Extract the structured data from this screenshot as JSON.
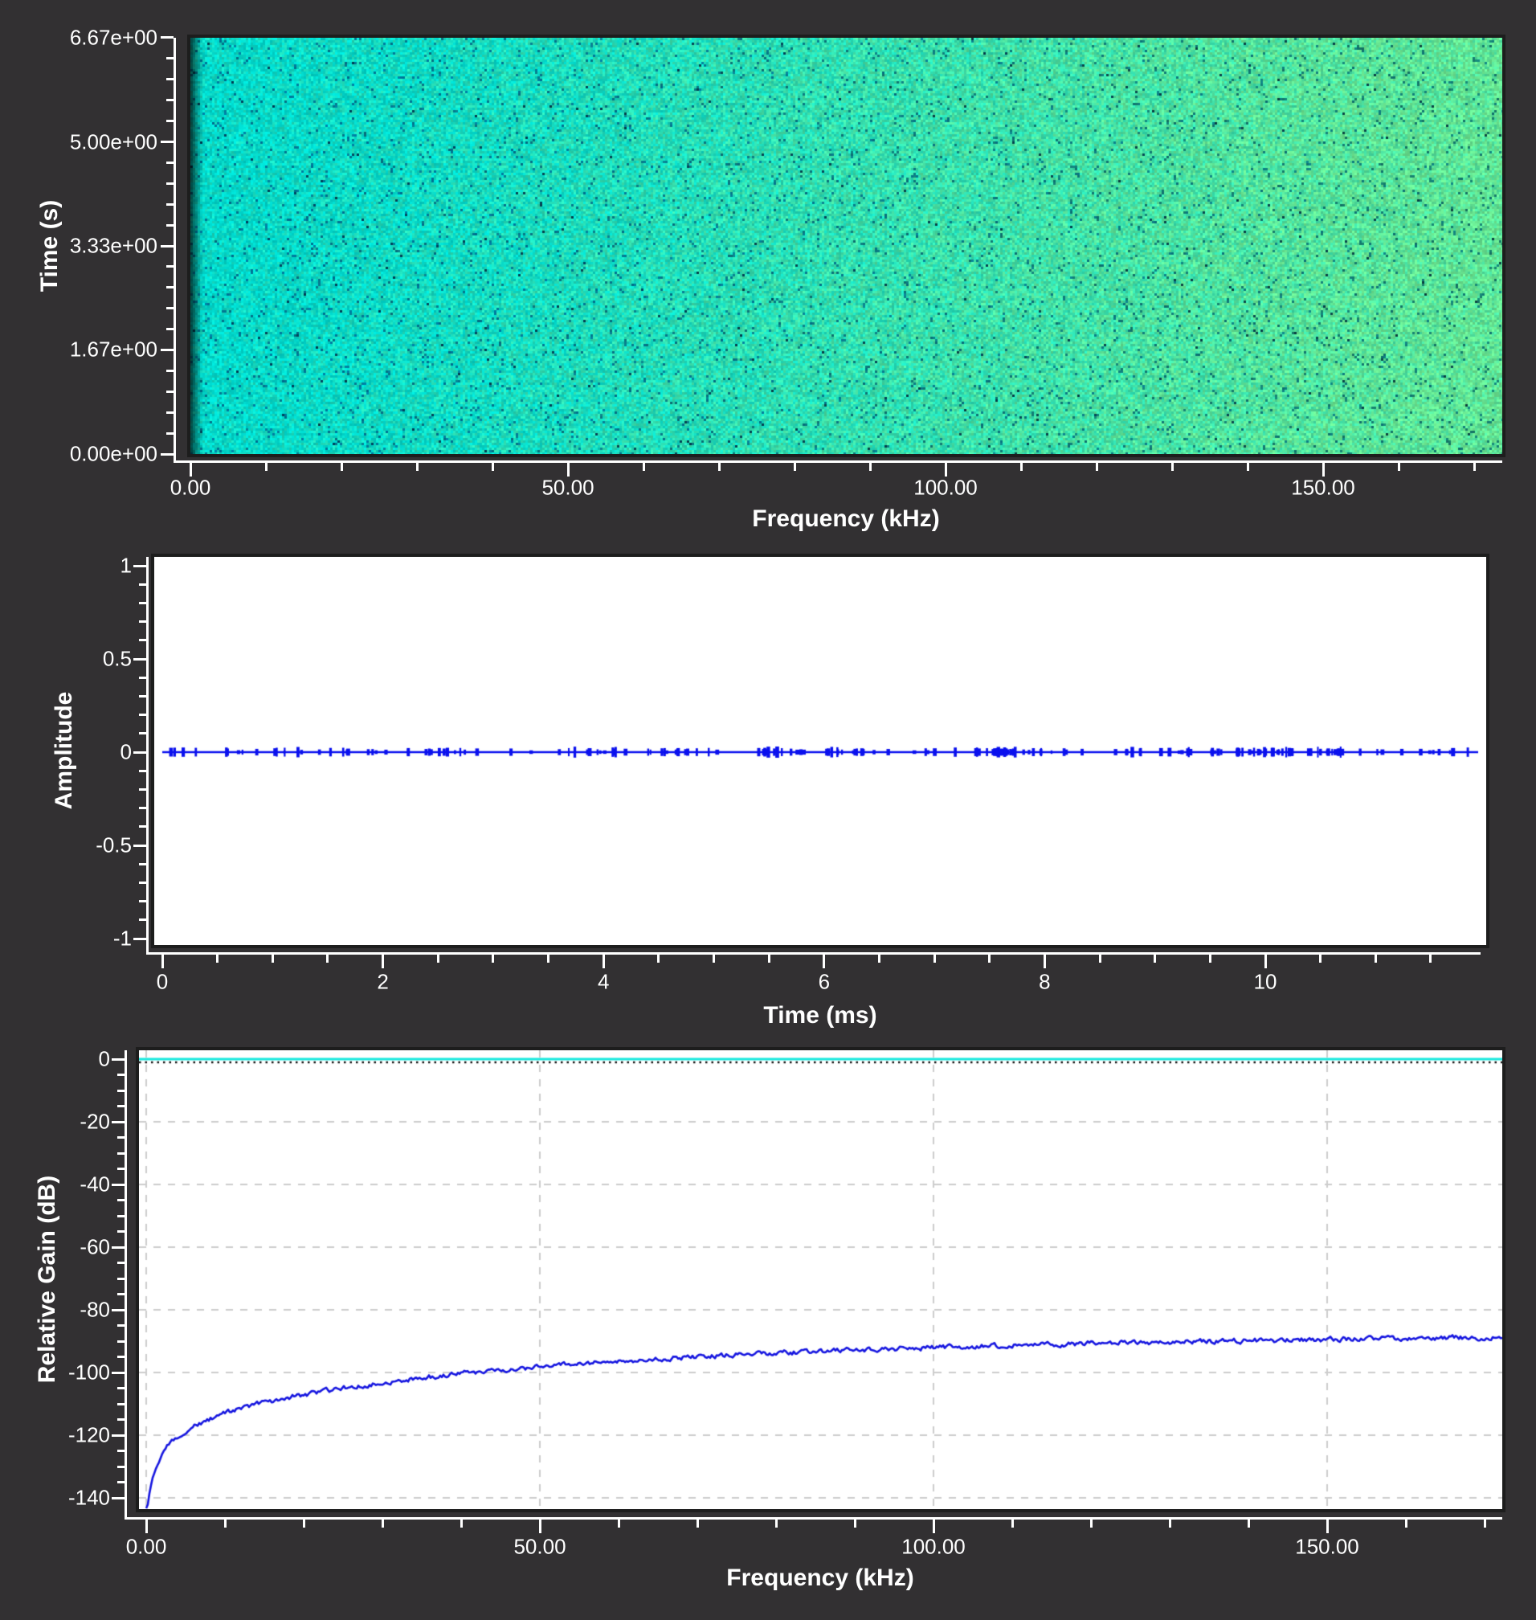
{
  "window": {
    "background": "#323032",
    "axis_color": "#ffffff",
    "plot_background": "#ffffff"
  },
  "chart_data": [
    {
      "type": "heatmap",
      "name": "spectrogram",
      "xlabel": "Frequency (kHz)",
      "ylabel": "Time (s)",
      "xlim": [
        0,
        173.7
      ],
      "ylim": [
        0,
        6.667
      ],
      "x_ticks": [
        {
          "v": 0,
          "label": "0.00"
        },
        {
          "v": 50,
          "label": "50.00"
        },
        {
          "v": 100,
          "label": "100.00"
        },
        {
          "v": 150,
          "label": "150.00"
        }
      ],
      "y_ticks": [
        {
          "v": 6.6667,
          "label": "6.67e+00"
        },
        {
          "v": 5.0,
          "label": "5.00e+00"
        },
        {
          "v": 3.3333,
          "label": "3.33e+00"
        },
        {
          "v": 1.6667,
          "label": "1.67e+00"
        },
        {
          "v": 0,
          "label": "0.00e+00"
        }
      ],
      "x_minor": {
        "step": 10,
        "min": 10,
        "max": 170
      },
      "y_minor": {
        "step": 0.33333,
        "min": 0.33333,
        "max": 6.5
      },
      "palette": {
        "low_freq_color": "#00d9ce",
        "high_freq_color": "#6ae792",
        "speckle_color": "#0e7d92",
        "edge_color": "#007f79",
        "description": "uniform broadband noise field; bright cyan at low frequencies blending to pale green at high frequencies, sparse dark teal speckles, darker teal gradient on first ~12px at left edge"
      }
    },
    {
      "type": "line",
      "name": "waveform",
      "xlabel": "Time (ms)",
      "ylabel": "Amplitude",
      "xlim": [
        -0.07,
        11.93
      ],
      "ylim": [
        -1.04,
        1.04
      ],
      "x_ticks": [
        {
          "v": 0,
          "label": "0"
        },
        {
          "v": 2,
          "label": "2"
        },
        {
          "v": 4,
          "label": "4"
        },
        {
          "v": 6,
          "label": "6"
        },
        {
          "v": 8,
          "label": "8"
        },
        {
          "v": 10,
          "label": "10"
        }
      ],
      "y_ticks": [
        {
          "v": 1,
          "label": "1"
        },
        {
          "v": 0.5,
          "label": "0.5"
        },
        {
          "v": 0,
          "label": "0"
        },
        {
          "v": -0.5,
          "label": "-0.5"
        },
        {
          "v": -1,
          "label": "-1"
        }
      ],
      "x_minor": {
        "step": 0.5,
        "min": 0.5,
        "max": 11.5
      },
      "y_minor": {
        "step": 0.1,
        "min": -1,
        "max": 1
      },
      "series": [
        {
          "name": "impulse-train",
          "color": "#0a10ee",
          "baseline": 0,
          "impulse_amplitude_max": 0.02,
          "impulse_count": 200,
          "x_start": 0,
          "x_end": 11.93,
          "description": "flat line at amplitude 0 spanning 0 to ~11.9 ms with ~200 sparse tiny impulses (|a| < 0.02) in irregular clusters"
        }
      ]
    },
    {
      "type": "line",
      "name": "frequency-response",
      "xlabel": "Frequency (kHz)",
      "ylabel": "Relative Gain (dB)",
      "xlim": [
        -0.9,
        172.2
      ],
      "ylim": [
        -143.6,
        2.8
      ],
      "x_ticks": [
        {
          "v": 0,
          "label": "0.00"
        },
        {
          "v": 50,
          "label": "50.00"
        },
        {
          "v": 100,
          "label": "100.00"
        },
        {
          "v": 150,
          "label": "150.00"
        }
      ],
      "y_ticks": [
        {
          "v": 0,
          "label": "0"
        },
        {
          "v": -20,
          "label": "-20"
        },
        {
          "v": -40,
          "label": "-40"
        },
        {
          "v": -60,
          "label": "-60"
        },
        {
          "v": -80,
          "label": "-80"
        },
        {
          "v": -100,
          "label": "-100"
        },
        {
          "v": -120,
          "label": "-120"
        },
        {
          "v": -140,
          "label": "-140"
        }
      ],
      "x_minor": {
        "step": 10,
        "min": 10,
        "max": 170
      },
      "y_minor": {
        "step": 5,
        "min": -140,
        "max": -5
      },
      "grid": {
        "show": true,
        "color": "#cdcdcd",
        "style": "dashed",
        "x_lines": [
          0,
          50,
          100,
          150
        ],
        "y_lines": [
          -20,
          -40,
          -60,
          -80,
          -100,
          -120,
          -140
        ]
      },
      "reference_line": {
        "v": 0,
        "color": "#1ae9de",
        "dotted_overlay_color": "#161616"
      },
      "series": [
        {
          "name": "relative-gain",
          "color": "#1616e0",
          "noise_db": 0.9,
          "points": [
            [
              0.05,
              -144
            ],
            [
              0.3,
              -140.5
            ],
            [
              0.7,
              -135
            ],
            [
              1.2,
              -130.5
            ],
            [
              2,
              -126.3
            ],
            [
              3,
              -122.8
            ],
            [
              4,
              -120.4
            ],
            [
              5,
              -118.6
            ],
            [
              6.5,
              -116.6
            ],
            [
              8,
              -115
            ],
            [
              10,
              -113.1
            ],
            [
              12.5,
              -111.2
            ],
            [
              15,
              -109.7
            ],
            [
              18,
              -108
            ],
            [
              22,
              -106.2
            ],
            [
              26,
              -104.6
            ],
            [
              30,
              -103.2
            ],
            [
              35,
              -101.7
            ],
            [
              40,
              -100.4
            ],
            [
              45,
              -99.2
            ],
            [
              50,
              -98.2
            ],
            [
              56,
              -97
            ],
            [
              62,
              -96
            ],
            [
              70,
              -94.9
            ],
            [
              78,
              -94
            ],
            [
              86,
              -93.2
            ],
            [
              95,
              -92.4
            ],
            [
              105,
              -91.7
            ],
            [
              115,
              -91
            ],
            [
              125,
              -90.5
            ],
            [
              138,
              -89.9
            ],
            [
              150,
              -89.4
            ],
            [
              160,
              -89.1
            ],
            [
              172,
              -88.8
            ]
          ]
        }
      ]
    }
  ]
}
